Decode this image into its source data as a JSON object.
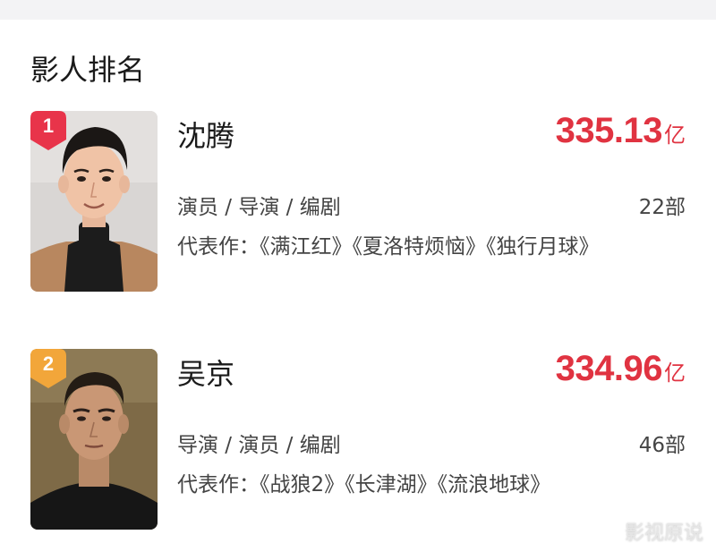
{
  "section": {
    "title": "影人排名"
  },
  "people": [
    {
      "rank": "1",
      "name": "沈腾",
      "box_office": "335.13",
      "box_office_unit": "亿",
      "roles": "演员 / 导演 / 编剧",
      "works_count": "22部",
      "representative": "代表作：《满江红》《夏洛特烦恼》《独行月球》",
      "badge_color": "#e8344a"
    },
    {
      "rank": "2",
      "name": "吴京",
      "box_office": "334.96",
      "box_office_unit": "亿",
      "roles": "导演 / 演员 / 编剧",
      "works_count": "46部",
      "representative": "代表作：《战狼2》《长津湖》《流浪地球》",
      "badge_color": "#f2a63a"
    }
  ],
  "watermark": "影视原说",
  "colors": {
    "accent": "#e03341",
    "text": "#1a1a1a",
    "secondary": "#444444"
  }
}
